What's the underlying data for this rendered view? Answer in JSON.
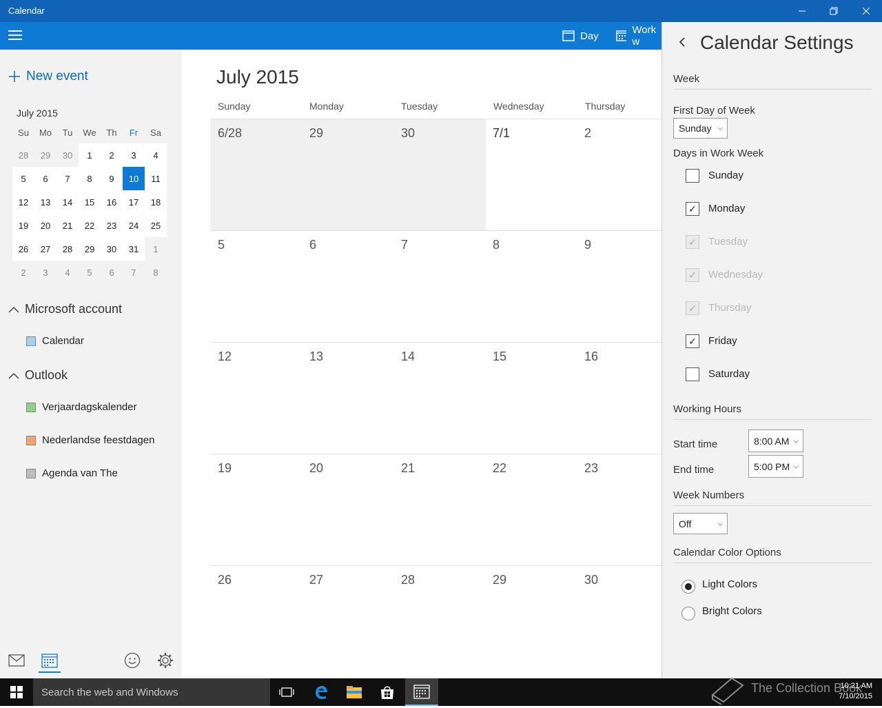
{
  "window": {
    "title": "Calendar"
  },
  "appbar": {
    "day_label": "Day",
    "workweek_label": "Work w"
  },
  "sidebar": {
    "new_event": "New event",
    "mini_month": "July 2015",
    "weekdays": [
      "Su",
      "Mo",
      "Tu",
      "We",
      "Th",
      "Fr",
      "Sa"
    ],
    "weeks": [
      [
        "28",
        "29",
        "30",
        "1",
        "2",
        "3",
        "4"
      ],
      [
        "5",
        "6",
        "7",
        "8",
        "9",
        "10",
        "11"
      ],
      [
        "12",
        "13",
        "14",
        "15",
        "16",
        "17",
        "18"
      ],
      [
        "19",
        "20",
        "21",
        "22",
        "23",
        "24",
        "25"
      ],
      [
        "26",
        "27",
        "28",
        "29",
        "30",
        "31",
        "1"
      ],
      [
        "2",
        "3",
        "4",
        "5",
        "6",
        "7",
        "8"
      ]
    ],
    "selected_day": "10",
    "groups": [
      {
        "label": "Microsoft account",
        "items": [
          {
            "label": "Calendar",
            "color": "#a7cdf0"
          }
        ]
      },
      {
        "label": "Outlook",
        "items": [
          {
            "label": "Verjaardagskalender",
            "color": "#8fd18a"
          },
          {
            "label": "Nederlandse feestdagen",
            "color": "#f2a46a"
          },
          {
            "label": "Agenda van The",
            "color": "#bdbdbd"
          }
        ]
      }
    ]
  },
  "main": {
    "month_title": "July 2015",
    "day_headers": [
      "Sunday",
      "Monday",
      "Tuesday",
      "Wednesday",
      "Thursday"
    ],
    "weeks": [
      [
        "6/28",
        "29",
        "30",
        "7/1",
        "2"
      ],
      [
        "5",
        "6",
        "7",
        "8",
        "9"
      ],
      [
        "12",
        "13",
        "14",
        "15",
        "16"
      ],
      [
        "19",
        "20",
        "21",
        "22",
        "23"
      ],
      [
        "26",
        "27",
        "28",
        "29",
        "30"
      ]
    ]
  },
  "settings": {
    "title": "Calendar Settings",
    "week_section": "Week",
    "first_day_label": "First Day of Week",
    "first_day_value": "Sunday",
    "work_week_label": "Days in Work Week",
    "days": [
      {
        "label": "Sunday",
        "checked": false,
        "disabled": false
      },
      {
        "label": "Monday",
        "checked": true,
        "disabled": false
      },
      {
        "label": "Tuesday",
        "checked": true,
        "disabled": true
      },
      {
        "label": "Wednesday",
        "checked": true,
        "disabled": true
      },
      {
        "label": "Thursday",
        "checked": true,
        "disabled": true
      },
      {
        "label": "Friday",
        "checked": true,
        "disabled": false
      },
      {
        "label": "Saturday",
        "checked": false,
        "disabled": false
      }
    ],
    "working_hours_section": "Working Hours",
    "start_time_label": "Start time",
    "start_time_value": "8:00 AM",
    "end_time_label": "End time",
    "end_time_value": "5:00 PM",
    "week_numbers_section": "Week Numbers",
    "week_numbers_value": "Off",
    "color_section": "Calendar Color Options",
    "color_options": [
      {
        "label": "Light Colors",
        "selected": true
      },
      {
        "label": "Bright Colors",
        "selected": false
      }
    ]
  },
  "taskbar": {
    "search_placeholder": "Search the web and Windows",
    "watermark": "The Collection Book",
    "time": "10:21 AM",
    "date": "7/10/2015"
  },
  "colors": {
    "accent": "#0e7ad3",
    "titlebar": "#1063b6",
    "taskbar": "#101010"
  }
}
